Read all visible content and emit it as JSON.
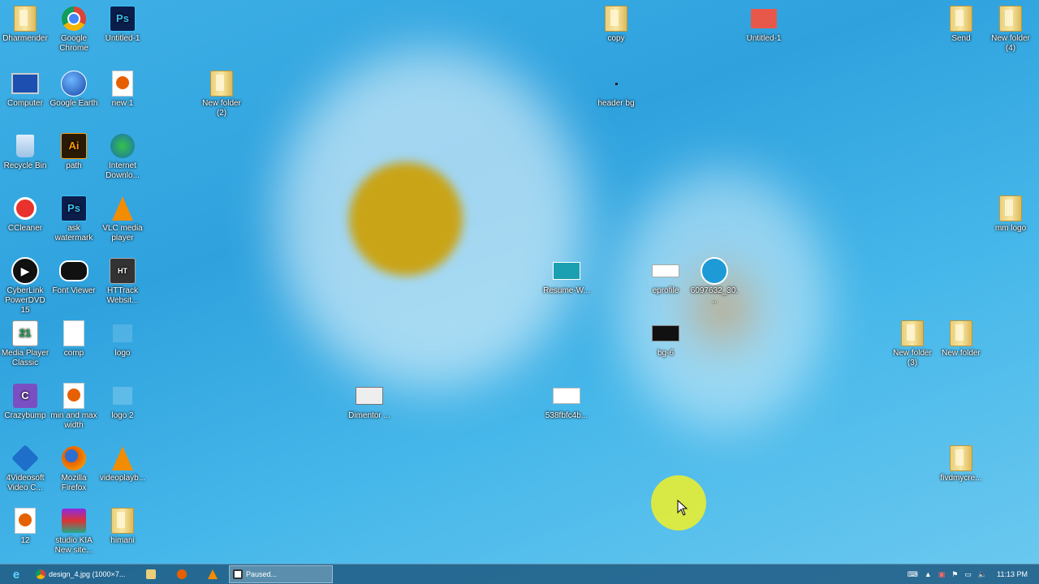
{
  "desktop_icons": {
    "dharmender": "Dharmender",
    "google_chrome": "Google Chrome",
    "untitled1_ps": "Untitled-1",
    "computer": "Computer",
    "google_earth": "Google Earth",
    "new1": "new 1",
    "new_folder_2": "New folder (2)",
    "recycle_bin": "Recycle Bin",
    "path": "path",
    "internet_download": "Internet Downlo...",
    "ccleaner": "CCleaner",
    "ask_watermark": "ask watermark",
    "vlc": "VLC media player",
    "cyberlink": "CyberLink PowerDVD 15",
    "font_viewer": "Font Viewer",
    "httrack": "HTTrack Websit...",
    "media_player_classic": "Media Player Classic",
    "comp": "comp",
    "logo": "logo",
    "crazybump": "Crazybump",
    "min_max_width": "min and max width",
    "logo2": "logo 2",
    "videosoft": "4Videosoft Video C...",
    "mozilla_firefox": "Mozilla Firefox",
    "videoplayb": "videoplayb...",
    "twelve": "12",
    "studio_kia": "studio KIA New site...",
    "himani": "himani",
    "copy": "copy",
    "header_bg": "header bg",
    "untitled1_red": "Untitled-1",
    "send": "Send",
    "new_folder_4": "New folder (4)",
    "mm_logo": "mm logo",
    "resume": "Resume-W...",
    "eprofile": "eprofile",
    "file_6097632": "6097632_30...",
    "bg6": "bg-6",
    "dimentor": "Dimentor ...",
    "file_538": "538fbfc4b...",
    "new_folder_3": "New folder (3)",
    "new_folder": "New folder",
    "fivdmycre": "fivdmycre..."
  },
  "taskbar": {
    "task1": "design_4.jpg (1000×7...",
    "task2": "Paused...",
    "clock": "11:13 PM"
  },
  "colors": {
    "sky": "#2fa2de",
    "cursor_highlight": "#f0f028",
    "taskbar": "#1e5a82"
  }
}
